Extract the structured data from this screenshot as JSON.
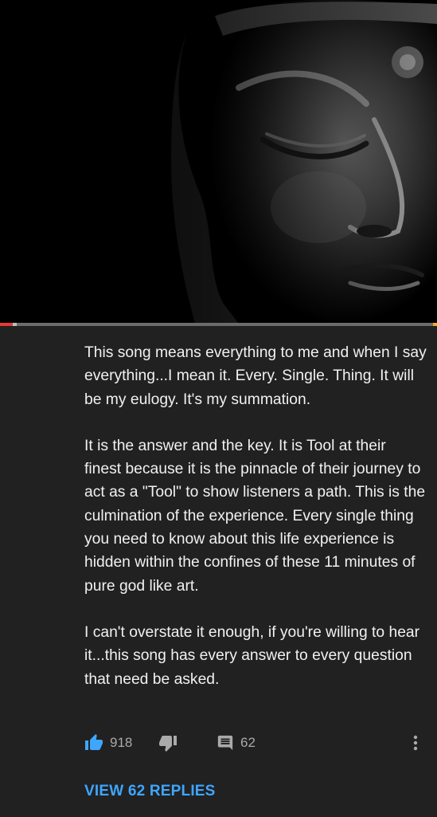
{
  "video": {
    "thumbnail_icon": "buddha-statue-image",
    "progress_fraction": 0.03,
    "colors": {
      "progress_played": "#e53935",
      "progress_track": "#6b6b6b"
    }
  },
  "comment": {
    "paragraphs": [
      "This song means everything to me and when I say everything...I mean it. Every. Single. Thing. It will be my eulogy. It's my summation.",
      "It is the answer and the key. It is Tool at their finest because it is the pinnacle of their journey to act as a \"Tool\" to show listeners a path. This is the culmination of the experience. Every single thing you need to know about this life experience is hidden within the confines of these 11 minutes of pure god like art.",
      "I can't overstate it enough, if you're willing to hear it...this song has every answer to every question that need be asked."
    ],
    "like_count": "918",
    "reply_count": "62",
    "icons": {
      "like": "thumb-up-icon",
      "dislike": "thumb-down-icon",
      "reply": "comment-icon",
      "more": "more-vert-icon"
    },
    "like_active_color": "#3ea6ff"
  },
  "replies": {
    "view_label": "VIEW 62 REPLIES"
  }
}
